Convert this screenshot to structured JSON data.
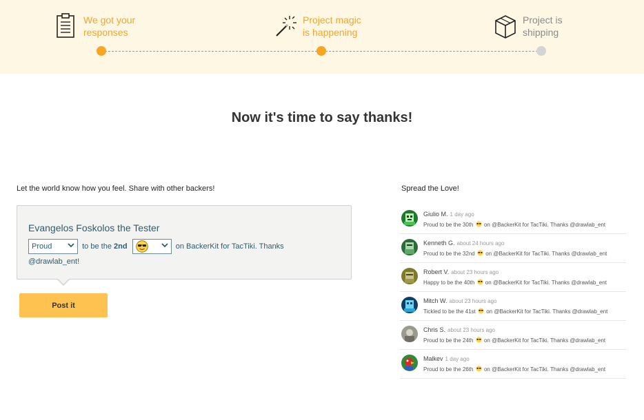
{
  "progress": {
    "steps": [
      {
        "line1": "We got your",
        "line2": "responses",
        "state": "done",
        "icon": "clipboard-icon"
      },
      {
        "line1": "Project magic",
        "line2": "is happening",
        "state": "done",
        "icon": "magic-wand-icon"
      },
      {
        "line1": "Project is",
        "line2": "shipping",
        "state": "todo",
        "icon": "box-icon"
      }
    ],
    "accent_color": "#f6a623",
    "inactive_color": "#d4d4d4"
  },
  "headline": "Now it's time to say thanks!",
  "share": {
    "label": "Let the world know how you feel. Share with other backers!",
    "name": "Evangelos Foskolos the Tester",
    "feeling": "Proud",
    "to_be_the": "to be the",
    "ordinal": "2nd",
    "emoji": "sunglasses-emoji-icon",
    "suffix": "on BackerKit for TacTiki. Thanks",
    "handle": "@drawlab_ent!",
    "post_button": "Post it",
    "button_color": "#fdc24f"
  },
  "feed": {
    "label": "Spread the Love!",
    "items": [
      {
        "name": "Giulio M.",
        "time": "1 day ago",
        "pre": "Proud to be the 30th",
        "post": "on @BackerKit for TacTiki. Thanks @drawlab_ent",
        "avatar": "green-pixel-avatar-icon"
      },
      {
        "name": "Kenneth G.",
        "time": "about 24 hours ago",
        "pre": "Proud to be the 32nd",
        "post": "on @BackerKit for TacTiki. Thanks @drawlab_ent",
        "avatar": "green-pixel-avatar-icon"
      },
      {
        "name": "Robert V.",
        "time": "about 23 hours ago",
        "pre": "Happy to be the 40th",
        "post": "on @BackerKit for TacTiki. Thanks @drawlab_ent",
        "avatar": "olive-pixel-avatar-icon"
      },
      {
        "name": "Mitch W.",
        "time": "about 23 hours ago",
        "pre": "Tickled to be the 41st",
        "post": "on @BackerKit for TacTiki. Thanks @drawlab_ent",
        "avatar": "blue-pixel-avatar-icon"
      },
      {
        "name": "Chris S.",
        "time": "about 23 hours ago",
        "pre": "Proud to be the 24th",
        "post": "on @BackerKit for TacTiki. Thanks @drawlab_ent",
        "avatar": "photo-avatar-icon"
      },
      {
        "name": "Malkev",
        "time": "1 day ago",
        "pre": "Proud to be the 26th",
        "post": "on @BackerKit for TacTiki. Thanks @drawlab_ent",
        "avatar": "parrot-avatar-icon"
      }
    ]
  }
}
